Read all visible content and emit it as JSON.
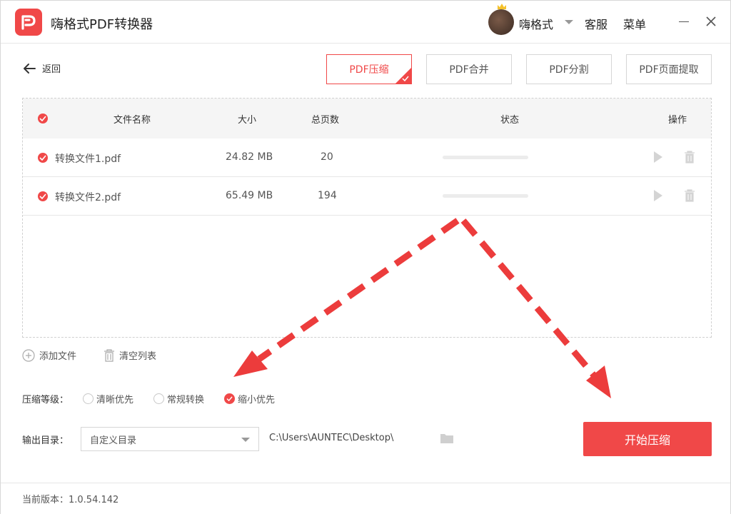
{
  "app": {
    "title": "嗨格式PDF转换器",
    "username": "嗨格式",
    "service_label": "客服",
    "menu_label": "菜单",
    "accent_color": "#f04848"
  },
  "toolbar": {
    "back_label": "返回",
    "tabs": [
      {
        "label": "PDF压缩",
        "active": true
      },
      {
        "label": "PDF合并",
        "active": false
      },
      {
        "label": "PDF分割",
        "active": false
      },
      {
        "label": "PDF页面提取",
        "active": false
      }
    ]
  },
  "table": {
    "headers": {
      "name": "文件名称",
      "size": "大小",
      "pages": "总页数",
      "status": "状态",
      "actions": "操作"
    },
    "rows": [
      {
        "name": "转换文件1.pdf",
        "size": "24.82 MB",
        "pages": "20",
        "progress": 0
      },
      {
        "name": "转换文件2.pdf",
        "size": "65.49 MB",
        "pages": "194",
        "progress": 0
      }
    ]
  },
  "actions": {
    "add_file": "添加文件",
    "clear_list": "清空列表"
  },
  "compression": {
    "label": "压缩等级：",
    "options": [
      {
        "label": "清晰优先",
        "selected": false
      },
      {
        "label": "常规转换",
        "selected": false
      },
      {
        "label": "缩小优先",
        "selected": true
      }
    ]
  },
  "output": {
    "label": "输出目录：",
    "selected": "自定义目录",
    "path": "C:\\Users\\AUNTEC\\Desktop\\",
    "start_label": "开始压缩"
  },
  "footer": {
    "version_text": "当前版本：1.0.54.142"
  }
}
